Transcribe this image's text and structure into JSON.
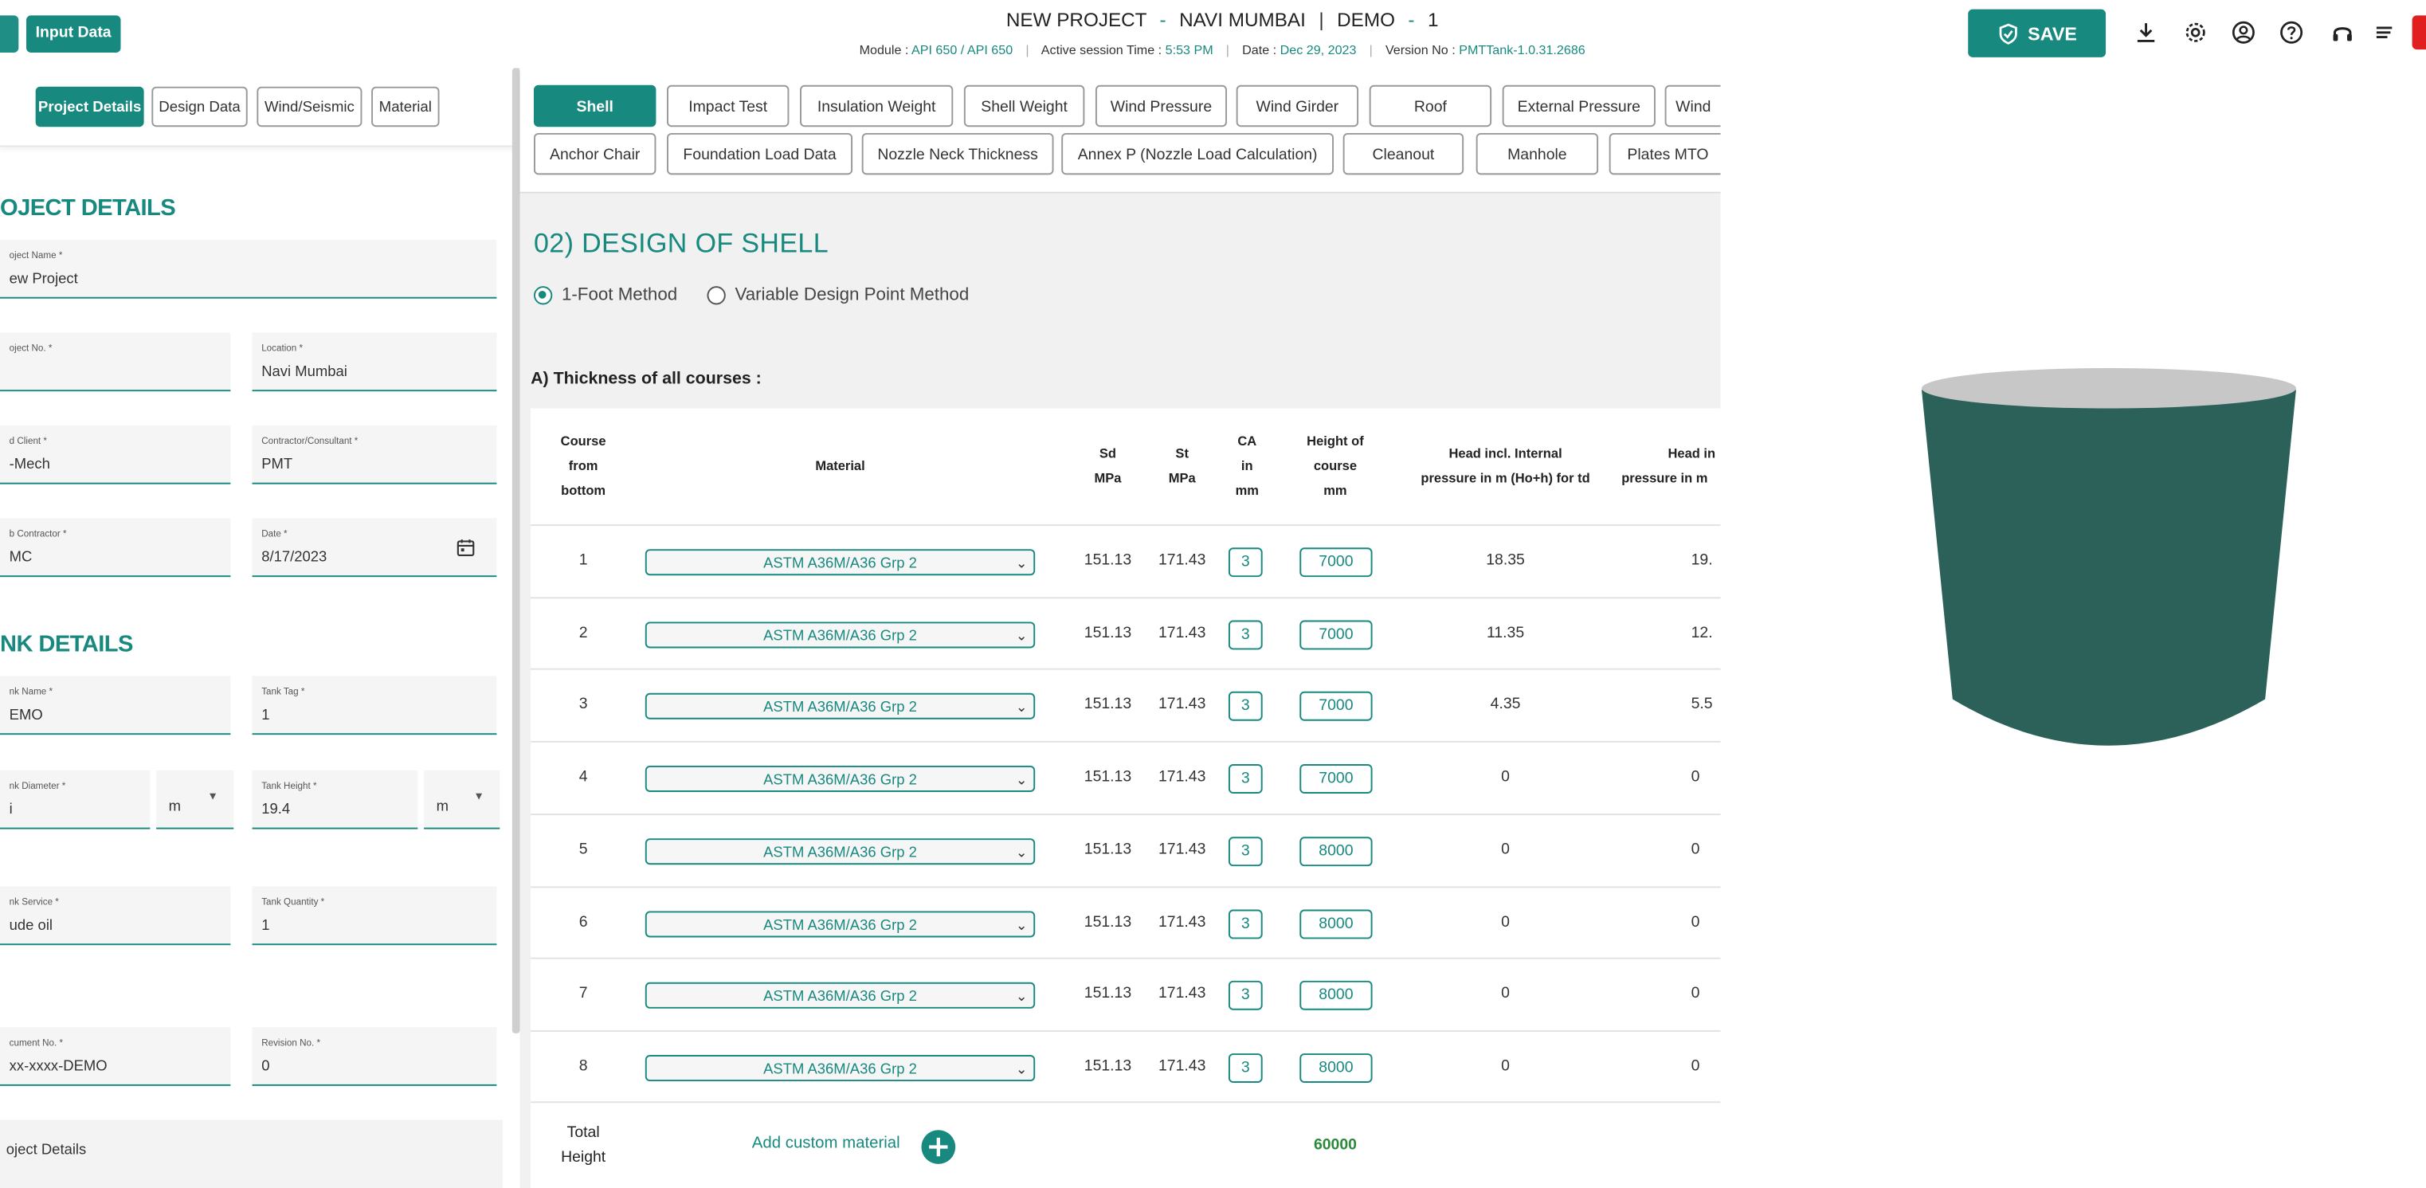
{
  "header": {
    "input_data_label": "Input Data",
    "title_project": "NEW PROJECT",
    "title_sep1": "-",
    "title_location": "NAVI MUMBAI",
    "title_sep2": "|",
    "title_tank": "DEMO",
    "title_sep3": "-",
    "title_num": "1",
    "module_label": "Module :",
    "module_value": "API 650 / API 650",
    "session_label": "Active session Time :",
    "session_value": "5:53 PM",
    "date_label": "Date :",
    "date_value": "Dec 29, 2023",
    "version_label": "Version No :",
    "version_value": "PMTTank-1.0.31.2686",
    "save_label": "SAVE"
  },
  "left_tabs": [
    "Project Details",
    "Design Data",
    "Wind/Seismic",
    "Material"
  ],
  "project_details": {
    "heading": "OJECT DETAILS",
    "project_name_label": "oject Name *",
    "project_name": "ew Project",
    "project_no_label": "oject No. *",
    "project_no": "",
    "location_label": "Location *",
    "location": "Navi Mumbai",
    "client_label": "d Client *",
    "client": "-Mech",
    "contractor_label": "Contractor/Consultant *",
    "contractor": "PMT",
    "sub_contractor_label": "b Contractor *",
    "sub_contractor": "MC",
    "date_label": "Date *",
    "date": "8/17/2023"
  },
  "tank_details": {
    "heading": "NK DETAILS",
    "tank_name_label": "nk Name *",
    "tank_name": "EMO",
    "tank_tag_label": "Tank Tag *",
    "tank_tag": "1",
    "diameter_label": "nk Diameter *",
    "diameter": "i",
    "diameter_unit": "m",
    "height_label": "Tank Height *",
    "height": "19.4",
    "height_unit": "m",
    "service_label": "nk Service *",
    "service": "ude oil",
    "quantity_label": "Tank Quantity *",
    "quantity": "1",
    "document_label": "cument No. *",
    "document": "xx-xxxx-DEMO",
    "revision_label": "Revision No. *",
    "revision": "0",
    "footer_label": "oject Details"
  },
  "mid_tabs_row1": [
    "Shell",
    "Impact Test",
    "Insulation Weight",
    "Shell Weight",
    "Wind Pressure",
    "Wind Girder",
    "Roof",
    "External Pressure",
    "Wind"
  ],
  "mid_tabs_row2": [
    "Anchor Chair",
    "Foundation Load Data",
    "Nozzle Neck Thickness",
    "Annex P (Nozzle Load Calculation)",
    "Cleanout",
    "Manhole",
    "Plates MTO"
  ],
  "shell": {
    "title": "02) DESIGN OF SHELL",
    "method1": "1-Foot Method",
    "method2": "Variable Design Point Method",
    "thickness_heading": "A) Thickness of all courses :",
    "col_course": [
      "Course",
      "from",
      "bottom"
    ],
    "col_material": "Material",
    "col_sd": [
      "Sd",
      "MPa"
    ],
    "col_st": [
      "St",
      "MPa"
    ],
    "col_ca": [
      "CA",
      "in",
      "mm"
    ],
    "col_height": [
      "Height of",
      "course",
      "mm"
    ],
    "col_head_td": [
      "Head incl. Internal",
      "pressure in m (Ho+h) for td"
    ],
    "col_head_tt": [
      "Head in",
      "pressure in m"
    ],
    "rows": [
      {
        "course": "1",
        "material": "ASTM A36M/A36 Grp 2",
        "sd": "151.13",
        "st": "171.43",
        "ca": "3",
        "height": "7000",
        "head_td": "18.35",
        "head_tt": "19."
      },
      {
        "course": "2",
        "material": "ASTM A36M/A36 Grp 2",
        "sd": "151.13",
        "st": "171.43",
        "ca": "3",
        "height": "7000",
        "head_td": "11.35",
        "head_tt": "12."
      },
      {
        "course": "3",
        "material": "ASTM A36M/A36 Grp 2",
        "sd": "151.13",
        "st": "171.43",
        "ca": "3",
        "height": "7000",
        "head_td": "4.35",
        "head_tt": "5.5"
      },
      {
        "course": "4",
        "material": "ASTM A36M/A36 Grp 2",
        "sd": "151.13",
        "st": "171.43",
        "ca": "3",
        "height": "7000",
        "head_td": "0",
        "head_tt": "0"
      },
      {
        "course": "5",
        "material": "ASTM A36M/A36 Grp 2",
        "sd": "151.13",
        "st": "171.43",
        "ca": "3",
        "height": "8000",
        "head_td": "0",
        "head_tt": "0"
      },
      {
        "course": "6",
        "material": "ASTM A36M/A36 Grp 2",
        "sd": "151.13",
        "st": "171.43",
        "ca": "3",
        "height": "8000",
        "head_td": "0",
        "head_tt": "0"
      },
      {
        "course": "7",
        "material": "ASTM A36M/A36 Grp 2",
        "sd": "151.13",
        "st": "171.43",
        "ca": "3",
        "height": "8000",
        "head_td": "0",
        "head_tt": "0"
      },
      {
        "course": "8",
        "material": "ASTM A36M/A36 Grp 2",
        "sd": "151.13",
        "st": "171.43",
        "ca": "3",
        "height": "8000",
        "head_td": "0",
        "head_tt": "0"
      }
    ],
    "total_label": [
      "Total",
      "Height"
    ],
    "add_custom_label": "Add custom material",
    "total_height": "60000"
  },
  "icons": [
    "download-icon",
    "gear-icon",
    "user-circle-icon",
    "help-icon",
    "headset-icon",
    "menu-icon",
    "calendar-icon",
    "plus-circle-icon",
    "check-shield-icon"
  ],
  "colors": {
    "accent": "#17897f",
    "tank_body": "#2b6158",
    "tank_top": "#c7c7c7"
  }
}
